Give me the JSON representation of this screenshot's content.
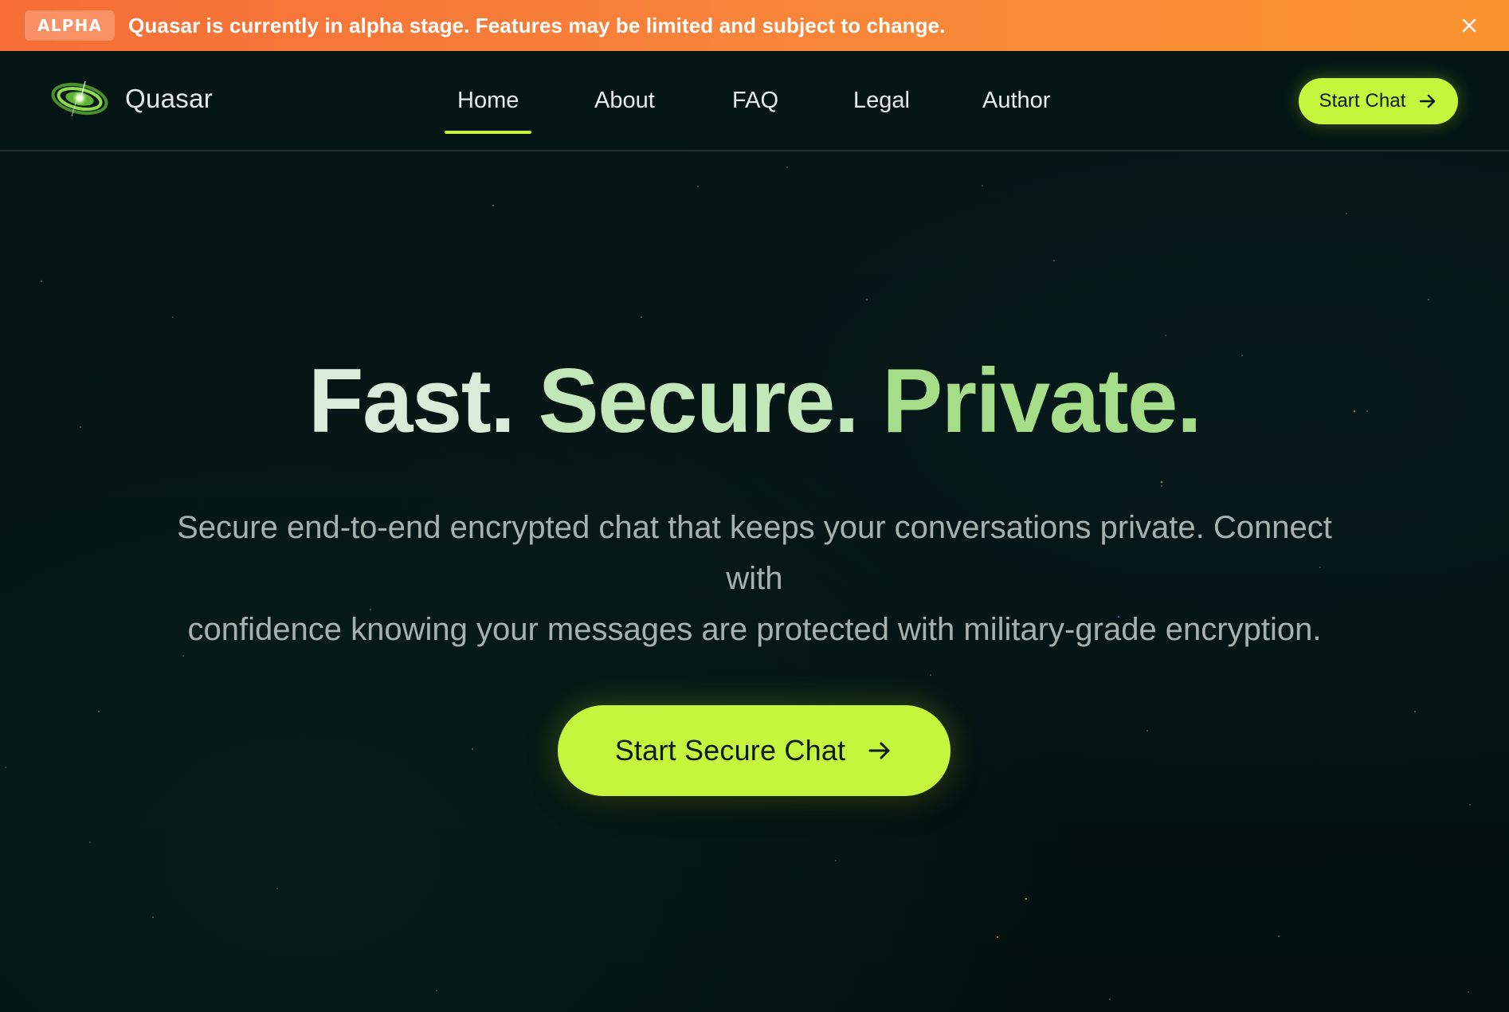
{
  "banner": {
    "badge": "ALPHA",
    "message": "Quasar is currently in alpha stage. Features may be limited and subject to change.",
    "close_icon": "close-icon"
  },
  "header": {
    "brand_name": "Quasar",
    "logo_icon": "galaxy-logo-icon",
    "nav": [
      {
        "label": "Home",
        "active": true
      },
      {
        "label": "About",
        "active": false
      },
      {
        "label": "FAQ",
        "active": false
      },
      {
        "label": "Legal",
        "active": false
      },
      {
        "label": "Author",
        "active": false
      }
    ],
    "cta_label": "Start Chat",
    "cta_icon": "arrow-right-icon"
  },
  "hero": {
    "title_words": [
      "Fast.",
      "Secure.",
      "Private."
    ],
    "subtitle_line1": "Secure end-to-end encrypted chat that keeps your conversations private. Connect with",
    "subtitle_line2": "confidence knowing your messages are protected with military-grade encryption.",
    "cta_label": "Start Secure Chat",
    "cta_icon": "arrow-right-icon"
  },
  "colors": {
    "banner_start": "#f66d37",
    "banner_end": "#fa9430",
    "accent": "#c6f53d",
    "background": "#051312",
    "title_gradient": [
      "#d9ecd9",
      "#c2e7b8",
      "#a6dd89"
    ]
  }
}
